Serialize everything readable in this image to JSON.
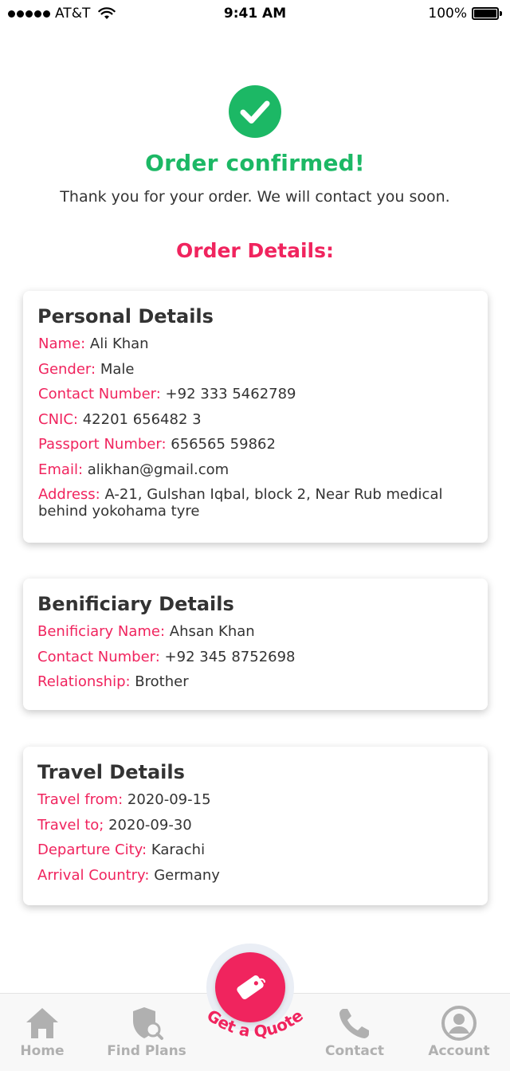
{
  "status_bar": {
    "carrier": "AT&T",
    "time": "9:41 AM",
    "battery": "100%"
  },
  "confirmation": {
    "title": "Order confirmed!",
    "message": "Thank you for your order. We will contact you soon."
  },
  "order_details_heading": "Order Details:",
  "personal": {
    "title": "Personal Details",
    "rows": [
      {
        "label": "Name:",
        "value": "Ali Khan"
      },
      {
        "label": "Gender:",
        "value": "Male"
      },
      {
        "label": "Contact Number:",
        "value": "+92 333 5462789"
      },
      {
        "label": "CNIC:",
        "value": "42201 656482 3"
      },
      {
        "label": "Passport Number:",
        "value": "656565 59862"
      },
      {
        "label": "Email:",
        "value": "alikhan@gmail.com"
      },
      {
        "label": "Address:",
        "value": "A-21, Gulshan Iqbal, block 2, Near Rub medical behind yokohama tyre"
      }
    ]
  },
  "beneficiary": {
    "title": "Benificiary Details",
    "rows": [
      {
        "label": "Benificiary Name:",
        "value": "Ahsan Khan"
      },
      {
        "label": "Contact Number:",
        "value": "+92 345 8752698"
      },
      {
        "label": "Relationship:",
        "value": "Brother"
      }
    ]
  },
  "travel": {
    "title": "Travel Details",
    "rows": [
      {
        "label": "Travel from:",
        "value": "2020-09-15"
      },
      {
        "label": "Travel to;",
        "value": "2020-09-30"
      },
      {
        "label": "Departure City:",
        "value": "Karachi"
      },
      {
        "label": "Arrival Country:",
        "value": "Germany"
      }
    ]
  },
  "bottom_nav": {
    "home": "Home",
    "find_plans": "Find Plans",
    "get_quote": "Get a Quote",
    "contact": "Contact",
    "account": "Account"
  },
  "colors": {
    "accent": "#f0245e",
    "success": "#1cb865",
    "nav_inactive": "#b0b0b0"
  },
  "icons": [
    "check-circle-icon",
    "home-icon",
    "shield-search-icon",
    "tag-icon",
    "phone-icon",
    "user-circle-icon",
    "wifi-icon",
    "battery-icon"
  ]
}
